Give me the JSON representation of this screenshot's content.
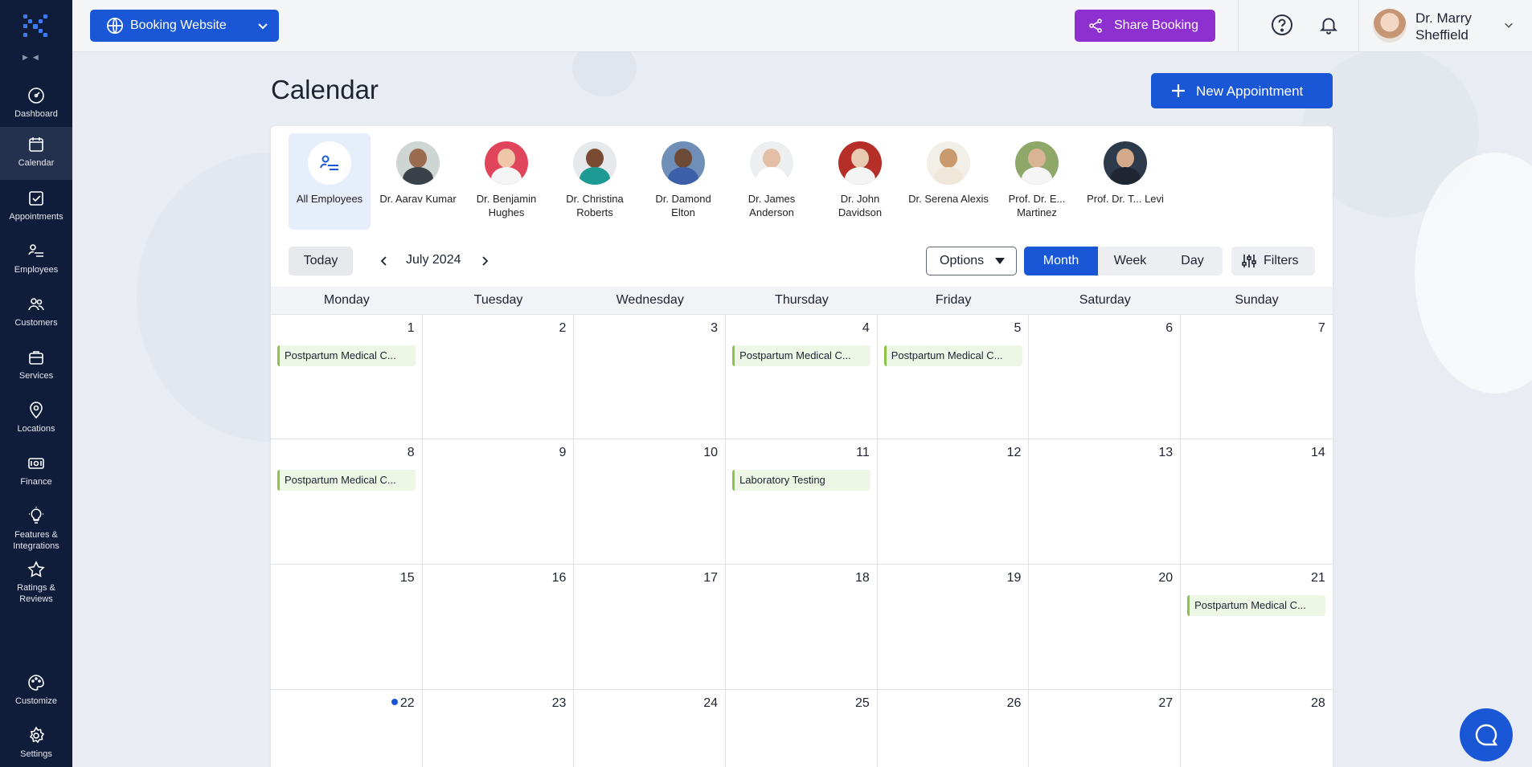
{
  "sidebar": {
    "items": [
      {
        "label": "Dashboard"
      },
      {
        "label": "Calendar"
      },
      {
        "label": "Appointments"
      },
      {
        "label": "Employees"
      },
      {
        "label": "Customers"
      },
      {
        "label": "Services"
      },
      {
        "label": "Locations"
      },
      {
        "label": "Finance"
      },
      {
        "label": "Features & Integrations"
      },
      {
        "label": "Ratings & Reviews"
      },
      {
        "label": "Customize"
      },
      {
        "label": "Settings"
      }
    ]
  },
  "topbar": {
    "booking_label": "Booking Website",
    "share_label": "Share Booking",
    "user_name": "Dr. Marry Sheffield"
  },
  "page": {
    "title": "Calendar",
    "new_appointment_label": "New Appointment"
  },
  "employees": [
    {
      "name": "All Employees"
    },
    {
      "name": "Dr. Aarav Kumar"
    },
    {
      "name": "Dr. Benjamin Hughes"
    },
    {
      "name": "Dr. Christina Roberts"
    },
    {
      "name": "Dr. Damond Elton"
    },
    {
      "name": "Dr. James Anderson"
    },
    {
      "name": "Dr. John Davidson"
    },
    {
      "name": "Dr. Serena Alexis"
    },
    {
      "name": "Prof. Dr. E... Martinez"
    },
    {
      "name": "Prof. Dr. T... Levi"
    }
  ],
  "toolbar": {
    "today_label": "Today",
    "month_label": "July 2024",
    "options_label": "Options",
    "views": [
      "Month",
      "Week",
      "Day"
    ],
    "active_view": "Month",
    "filters_label": "Filters"
  },
  "calendar": {
    "weekdays": [
      "Monday",
      "Tuesday",
      "Wednesday",
      "Thursday",
      "Friday",
      "Saturday",
      "Sunday"
    ],
    "weeks": [
      [
        {
          "day": "1",
          "event": "Postpartum Medical C..."
        },
        {
          "day": "2",
          "event": ""
        },
        {
          "day": "3",
          "event": ""
        },
        {
          "day": "4",
          "event": "Postpartum Medical C..."
        },
        {
          "day": "5",
          "event": "Postpartum Medical C..."
        },
        {
          "day": "6",
          "event": ""
        },
        {
          "day": "7",
          "event": ""
        }
      ],
      [
        {
          "day": "8",
          "event": "Postpartum Medical C..."
        },
        {
          "day": "9",
          "event": ""
        },
        {
          "day": "10",
          "event": ""
        },
        {
          "day": "11",
          "event": "Laboratory Testing"
        },
        {
          "day": "12",
          "event": ""
        },
        {
          "day": "13",
          "event": ""
        },
        {
          "day": "14",
          "event": ""
        }
      ],
      [
        {
          "day": "15",
          "event": ""
        },
        {
          "day": "16",
          "event": ""
        },
        {
          "day": "17",
          "event": ""
        },
        {
          "day": "18",
          "event": ""
        },
        {
          "day": "19",
          "event": ""
        },
        {
          "day": "20",
          "event": ""
        },
        {
          "day": "21",
          "event": "Postpartum Medical C..."
        }
      ],
      [
        {
          "day": "22",
          "event": "",
          "today": true
        },
        {
          "day": "23",
          "event": ""
        },
        {
          "day": "24",
          "event": ""
        },
        {
          "day": "25",
          "event": ""
        },
        {
          "day": "26",
          "event": ""
        },
        {
          "day": "27",
          "event": ""
        },
        {
          "day": "28",
          "event": ""
        }
      ]
    ]
  },
  "colors": {
    "primary": "#1a57d6",
    "share": "#8e2fcf",
    "sidebar": "#0f1c3a",
    "event_accent": "#8cc44a"
  }
}
